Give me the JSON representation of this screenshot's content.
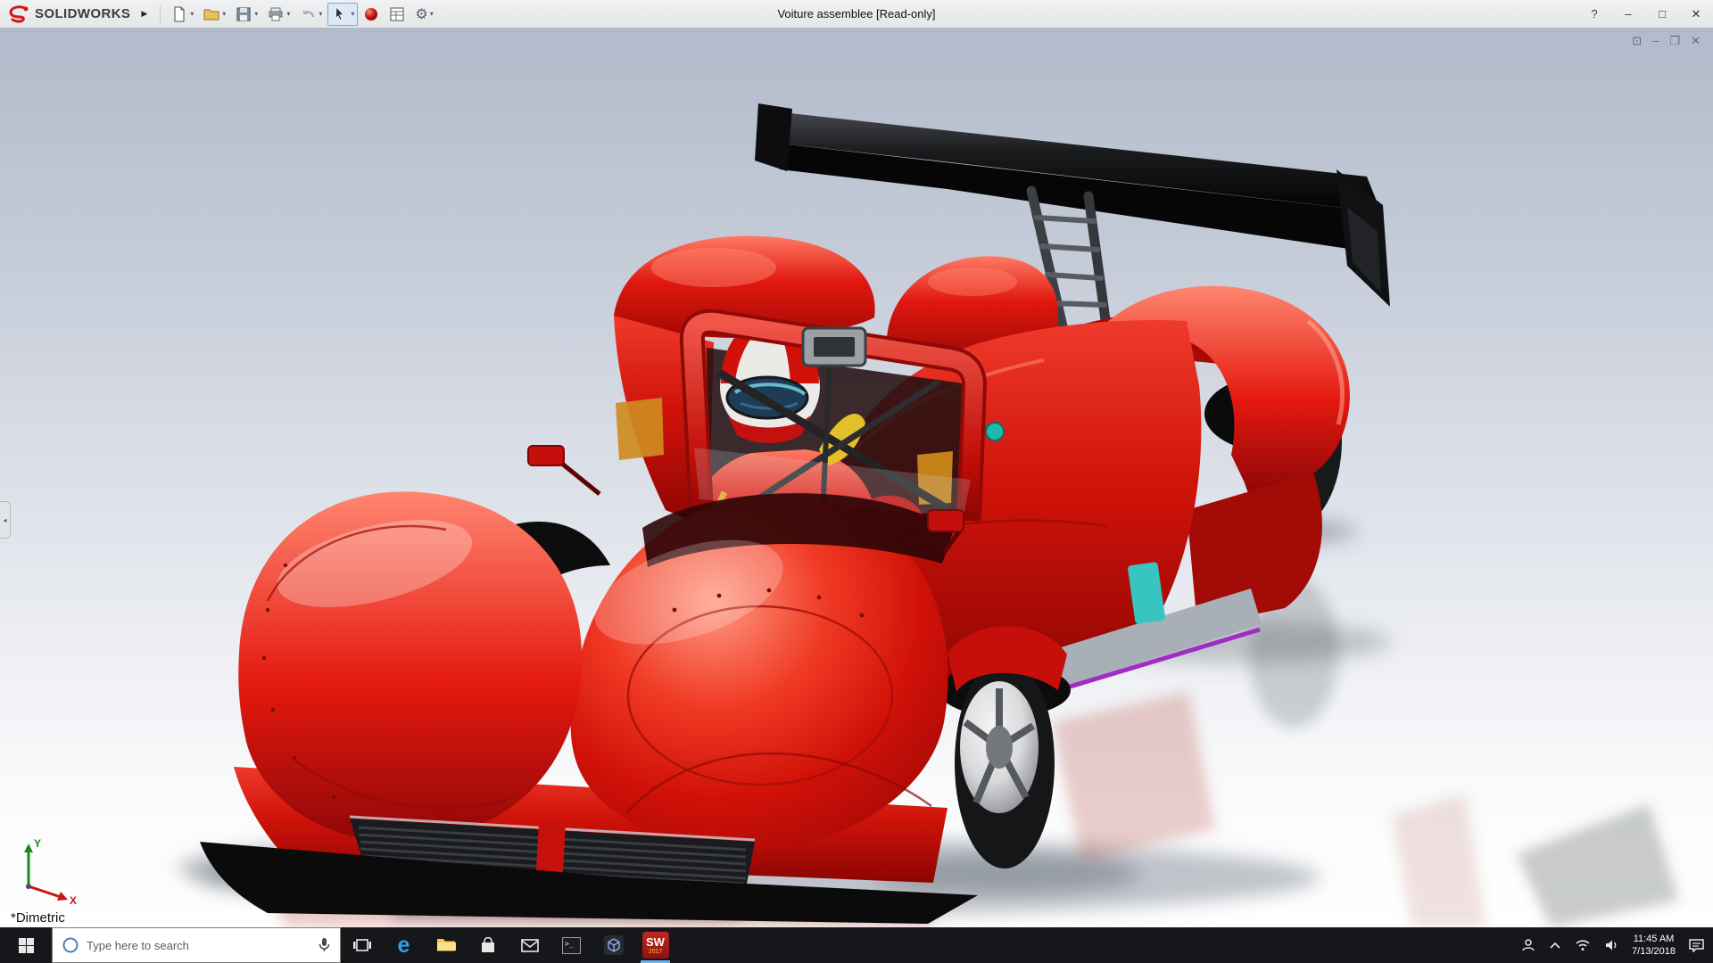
{
  "titlebar": {
    "brand": "SOLIDWORKS",
    "title": "Voiture assemblee [Read-only]"
  },
  "icons": {
    "expander": "▶",
    "caret": "▾",
    "gear": "⚙",
    "help": "?",
    "minimize": "–",
    "maximize": "□",
    "close": "✕",
    "child_pin": "⊡",
    "child_minimize": "–",
    "child_restore": "❐",
    "child_close": "✕",
    "collapse_arrow": "◂",
    "cmd_text": ">_",
    "edge": "e"
  },
  "viewport": {
    "view_orientation": "*Dimetric",
    "triad_x": "X",
    "triad_y": "Y"
  },
  "taskbar": {
    "search_placeholder": "Type here to search",
    "time": "11:45 AM",
    "date": "7/13/2018",
    "sw_label": "SW",
    "sw_year": "2017"
  }
}
